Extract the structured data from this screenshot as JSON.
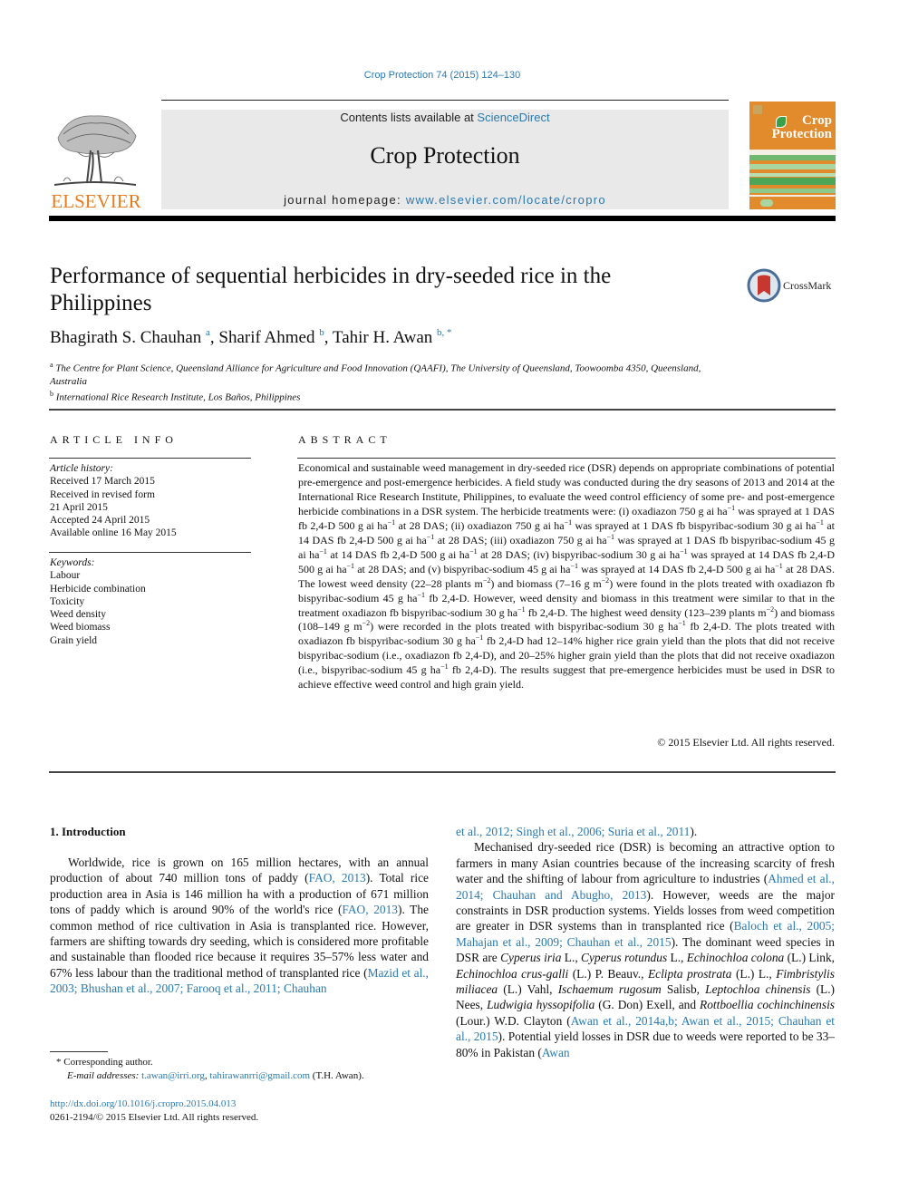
{
  "top_citation": "Crop Protection 74 (2015) 124–130",
  "header": {
    "publisher_logo_text": "ELSEVIER",
    "contents_prefix": "Contents lists available at ",
    "contents_link": "ScienceDirect",
    "journal_name": "Crop Protection",
    "homepage_prefix": "journal homepage: ",
    "homepage_link": "www.elsevier.com/locate/cropro",
    "cover_title_line1": "Crop",
    "cover_title_line2": "Protection",
    "colors": {
      "elsevier_orange": "#e77b1e",
      "cover_orange": "#e28b2c",
      "link_blue": "#2a7ab0",
      "banner_gray": "#e9e9e9"
    }
  },
  "article": {
    "title": "Performance of sequential herbicides in dry-seeded rice in the Philippines",
    "crossmark_label": "CrossMark",
    "authors": [
      {
        "name": "Bhagirath S. Chauhan",
        "sup": "a"
      },
      {
        "name": "Sharif Ahmed",
        "sup": "b"
      },
      {
        "name": "Tahir H. Awan",
        "sup": "b, *"
      }
    ],
    "affiliations": [
      {
        "key": "a",
        "text": "The Centre for Plant Science, Queensland Alliance for Agriculture and Food Innovation (QAAFI), The University of Queensland, Toowoomba 4350, Queensland, Australia"
      },
      {
        "key": "b",
        "text": "International Rice Research Institute, Los Baños, Philippines"
      }
    ]
  },
  "article_info": {
    "heading": "ARTICLE INFO",
    "history_label": "Article history:",
    "history": [
      "Received 17 March 2015",
      "Received in revised form",
      "21 April 2015",
      "Accepted 24 April 2015",
      "Available online 16 May 2015"
    ],
    "keywords_label": "Keywords:",
    "keywords": [
      "Labour",
      "Herbicide combination",
      "Toxicity",
      "Weed density",
      "Weed biomass",
      "Grain yield"
    ]
  },
  "abstract": {
    "heading": "ABSTRACT",
    "segments": [
      "Economical and sustainable weed management in dry-seeded rice (DSR) depends on appropriate combinations of potential pre-emergence and post-emergence herbicides. A field study was conducted during the dry seasons of 2013 and 2014 at the International Rice Research Institute, Philippines, to evaluate the weed control efficiency of some pre- and post-emergence herbicide combinations in a DSR system. The herbicide treatments were: (i) oxadiazon 750 g ai ha",
      " was sprayed at 1 DAS fb 2,4-D 500 g ai ha",
      " at 28 DAS; (ii) oxadiazon 750 g ai ha",
      " was sprayed at 1 DAS fb bispyribac-sodium 30 g ai ha",
      " at 14 DAS fb 2,4-D 500 g ai ha",
      " at 28 DAS; (iii) oxadiazon 750 g ai ha",
      " was sprayed at 1 DAS fb bispyribac-sodium 45 g ai ha",
      " at 14 DAS fb 2,4-D 500 g ai ha",
      " at 28 DAS; (iv) bispyribac-sodium 30 g ai ha",
      " was sprayed at 14 DAS fb 2,4-D 500 g ai ha",
      " at 28 DAS; and (v) bispyribac-sodium 45 g ai ha",
      " was sprayed at 14 DAS fb 2,4-D 500 g ai ha",
      " at 28 DAS. The lowest weed density (22–28 plants m",
      ") and biomass (7–16 g m",
      ") were found in the plots treated with oxadiazon fb bispyribac-sodium 45 g ha",
      " fb 2,4-D. However, weed density and biomass in this treatment were similar to that in the treatment oxadiazon fb bispyribac-sodium 30 g ha",
      " fb 2,4-D. The highest weed density (123–239 plants m",
      ") and biomass (108–149 g m",
      ") were recorded in the plots treated with bispyribac-sodium 30 g ha",
      " fb 2,4-D. The plots treated with oxadiazon fb bispyribac-sodium 30 g ha",
      " fb 2,4-D had 12–14% higher rice grain yield than the plots that did not receive bispyribac-sodium (i.e., oxadiazon fb 2,4-D), and 20–25% higher grain yield than the plots that did not receive oxadiazon (i.e., bispyribac-sodium 45 g ha",
      " fb 2,4-D). The results suggest that pre-emergence herbicides must be used in DSR to achieve effective weed control and high grain yield."
    ],
    "sup_minus1": "−1",
    "sup_minus2": "−2",
    "copyright": "© 2015 Elsevier Ltd. All rights reserved."
  },
  "body": {
    "section_heading": "1.  Introduction",
    "left_para": {
      "t1": "Worldwide, rice is grown on 165 million hectares, with an annual production of about 740 million tons of paddy (",
      "c1": "FAO, 2013",
      "t2": "). Total rice production area in Asia is 146 million ha with a production of 671 million tons of paddy which is around 90% of the world's rice (",
      "c2": "FAO, 2013",
      "t3": "). The common method of rice cultivation in Asia is transplanted rice. However, farmers are shifting towards dry seeding, which is considered more profitable and sustainable than flooded rice because it requires 35–57% less water and 67% less labour than the traditional method of transplanted rice (",
      "c3": "Mazid et al., 2003; Bhushan et al., 2007; Farooq et al., 2011; Chauhan"
    },
    "right_col": {
      "c0": "et al., 2012; Singh et al., 2006; Suria et al., 2011",
      "t0": ").",
      "p2_t1": "Mechanised dry-seeded rice (DSR) is becoming an attractive option to farmers in many Asian countries because of the increasing scarcity of fresh water and the shifting of labour from agriculture to industries (",
      "p2_c1": "Ahmed et al., 2014; Chauhan and Abugho, 2013",
      "p2_t2": "). However, weeds are the major constraints in DSR production systems. Yields losses from weed competition are greater in DSR systems than in transplanted rice (",
      "p2_c2": "Baloch et al., 2005; Mahajan et al., 2009; Chauhan et al., 2015",
      "p2_t3": "). The dominant weed species in DSR are ",
      "sp1": "Cyperus iria",
      "a1": " L., ",
      "sp2": "Cyperus rotundus",
      "a2": " L., ",
      "sp3": "Echinochloa colona",
      "a3": " (L.) Link, ",
      "sp4": "Echinochloa crus-galli",
      "a4": " (L.) P. Beauv., ",
      "sp5": "Eclipta prostrata",
      "a5": " (L.) L., ",
      "sp6": "Fimbristylis miliacea",
      "a6": " (L.) Vahl, ",
      "sp7": "Ischaemum rugosum",
      "a7": " Salisb, ",
      "sp8": "Leptochloa chinensis",
      "a8": " (L.) Nees, ",
      "sp9": "Ludwigia hyssopifolia",
      "a9": " (G. Don) Exell, and ",
      "sp10": "Rottboellia cochinchinensis",
      "a10": " (Lour.) W.D. Clayton (",
      "p2_c3": "Awan et al., 2014a,b; Awan et al., 2015; Chauhan et al., 2015",
      "p2_t4": "). Potential yield losses in DSR due to weeds were reported to be 33–80% in Pakistan (",
      "p2_c4": "Awan"
    }
  },
  "footnotes": {
    "corresponding": "* Corresponding author.",
    "email_label": "E-mail addresses: ",
    "email1": "t.awan@irri.org",
    "email_sep": ", ",
    "email2": "tahirawanrri@gmail.com",
    "email_suffix": " (T.H. Awan).",
    "doi": "http://dx.doi.org/10.1016/j.cropro.2015.04.013",
    "issn_line": "0261-2194/© 2015 Elsevier Ltd. All rights reserved."
  }
}
